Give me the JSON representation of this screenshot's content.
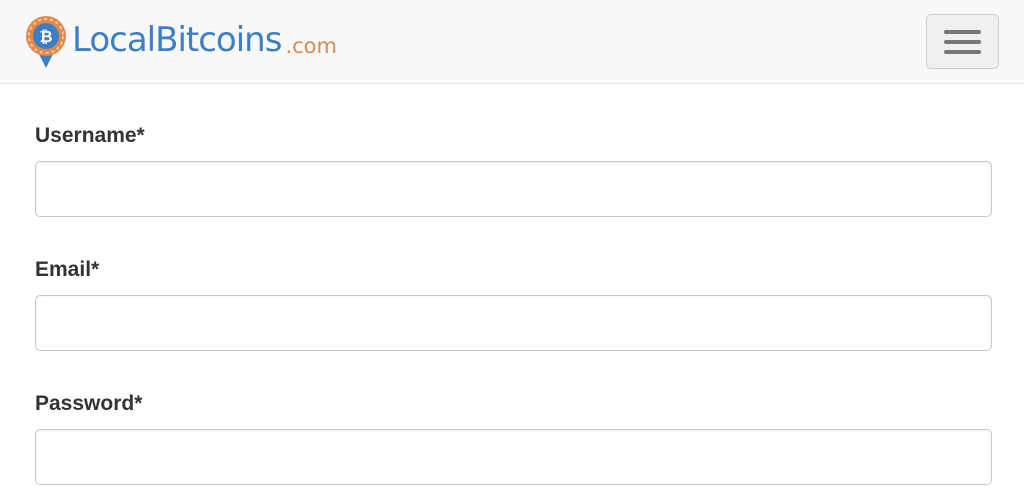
{
  "brand": {
    "name": "LocalBitcoins",
    "tld": ".com",
    "icon": "bitcoin-map-pin-logo",
    "colors": {
      "primary": "#3d7fc6",
      "accent": "#e0894a"
    }
  },
  "navbar": {
    "menu_icon": "hamburger-menu-icon"
  },
  "form": {
    "username": {
      "label": "Username*",
      "value": "",
      "placeholder": ""
    },
    "email": {
      "label": "Email*",
      "value": "",
      "placeholder": ""
    },
    "password": {
      "label": "Password*",
      "value": "",
      "placeholder": ""
    }
  }
}
